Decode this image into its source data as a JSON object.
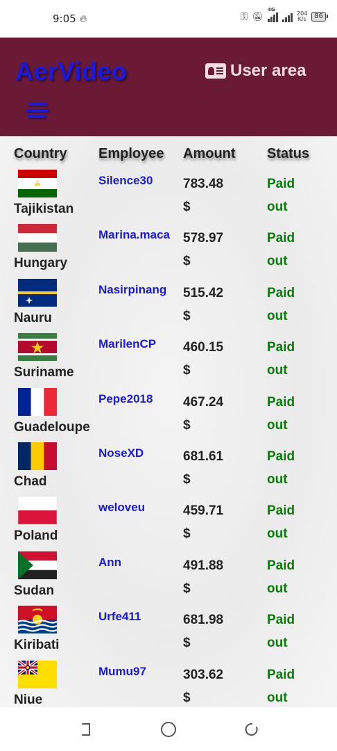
{
  "status_bar": {
    "time": "9:05",
    "network": "4G",
    "speed_value": "204",
    "speed_unit": "K/s",
    "battery": "86"
  },
  "header": {
    "brand": "AerVideo",
    "user_area": "User area"
  },
  "table": {
    "columns": [
      "Country",
      "Employee",
      "Amount",
      "Status"
    ],
    "rows": [
      {
        "country": "Tajikistan",
        "flag": "tajikistan-flag",
        "employee": "Silence30",
        "amount": "783.48",
        "currency": "$",
        "status_line1": "Paid",
        "status_line2": "out"
      },
      {
        "country": "Hungary",
        "flag": "hungary-flag",
        "employee": "Marina.maca",
        "amount": "578.97",
        "currency": "$",
        "status_line1": "Paid",
        "status_line2": "out"
      },
      {
        "country": "Nauru",
        "flag": "nauru-flag",
        "employee": "Nasirpinang",
        "amount": "515.42",
        "currency": "$",
        "status_line1": "Paid",
        "status_line2": "out"
      },
      {
        "country": "Suriname",
        "flag": "suriname-flag",
        "employee": "MarilenCP",
        "amount": "460.15",
        "currency": "$",
        "status_line1": "Paid",
        "status_line2": "out"
      },
      {
        "country": "Guadeloupe",
        "flag": "guadeloupe-flag",
        "employee": "Pepe2018",
        "amount": "467.24",
        "currency": "$",
        "status_line1": "Paid",
        "status_line2": "out"
      },
      {
        "country": "Chad",
        "flag": "chad-flag",
        "employee": "NoseXD",
        "amount": "681.61",
        "currency": "$",
        "status_line1": "Paid",
        "status_line2": "out"
      },
      {
        "country": "Poland",
        "flag": "poland-flag",
        "employee": "weloveu",
        "amount": "459.71",
        "currency": "$",
        "status_line1": "Paid",
        "status_line2": "out"
      },
      {
        "country": "Sudan",
        "flag": "sudan-flag",
        "employee": "Ann",
        "amount": "491.88",
        "currency": "$",
        "status_line1": "Paid",
        "status_line2": "out"
      },
      {
        "country": "Kiribati",
        "flag": "kiribati-flag",
        "employee": "Urfe411",
        "amount": "681.98",
        "currency": "$",
        "status_line1": "Paid",
        "status_line2": "out"
      },
      {
        "country": "Niue",
        "flag": "niue-flag",
        "employee": "Mumu97",
        "amount": "303.62",
        "currency": "$",
        "status_line1": "Paid",
        "status_line2": "out"
      }
    ]
  },
  "colors": {
    "header_bg": "#6b1a35",
    "brand": "#1a1adf",
    "employee_link": "#1a1adf",
    "status_paid": "#0a7a0a"
  }
}
